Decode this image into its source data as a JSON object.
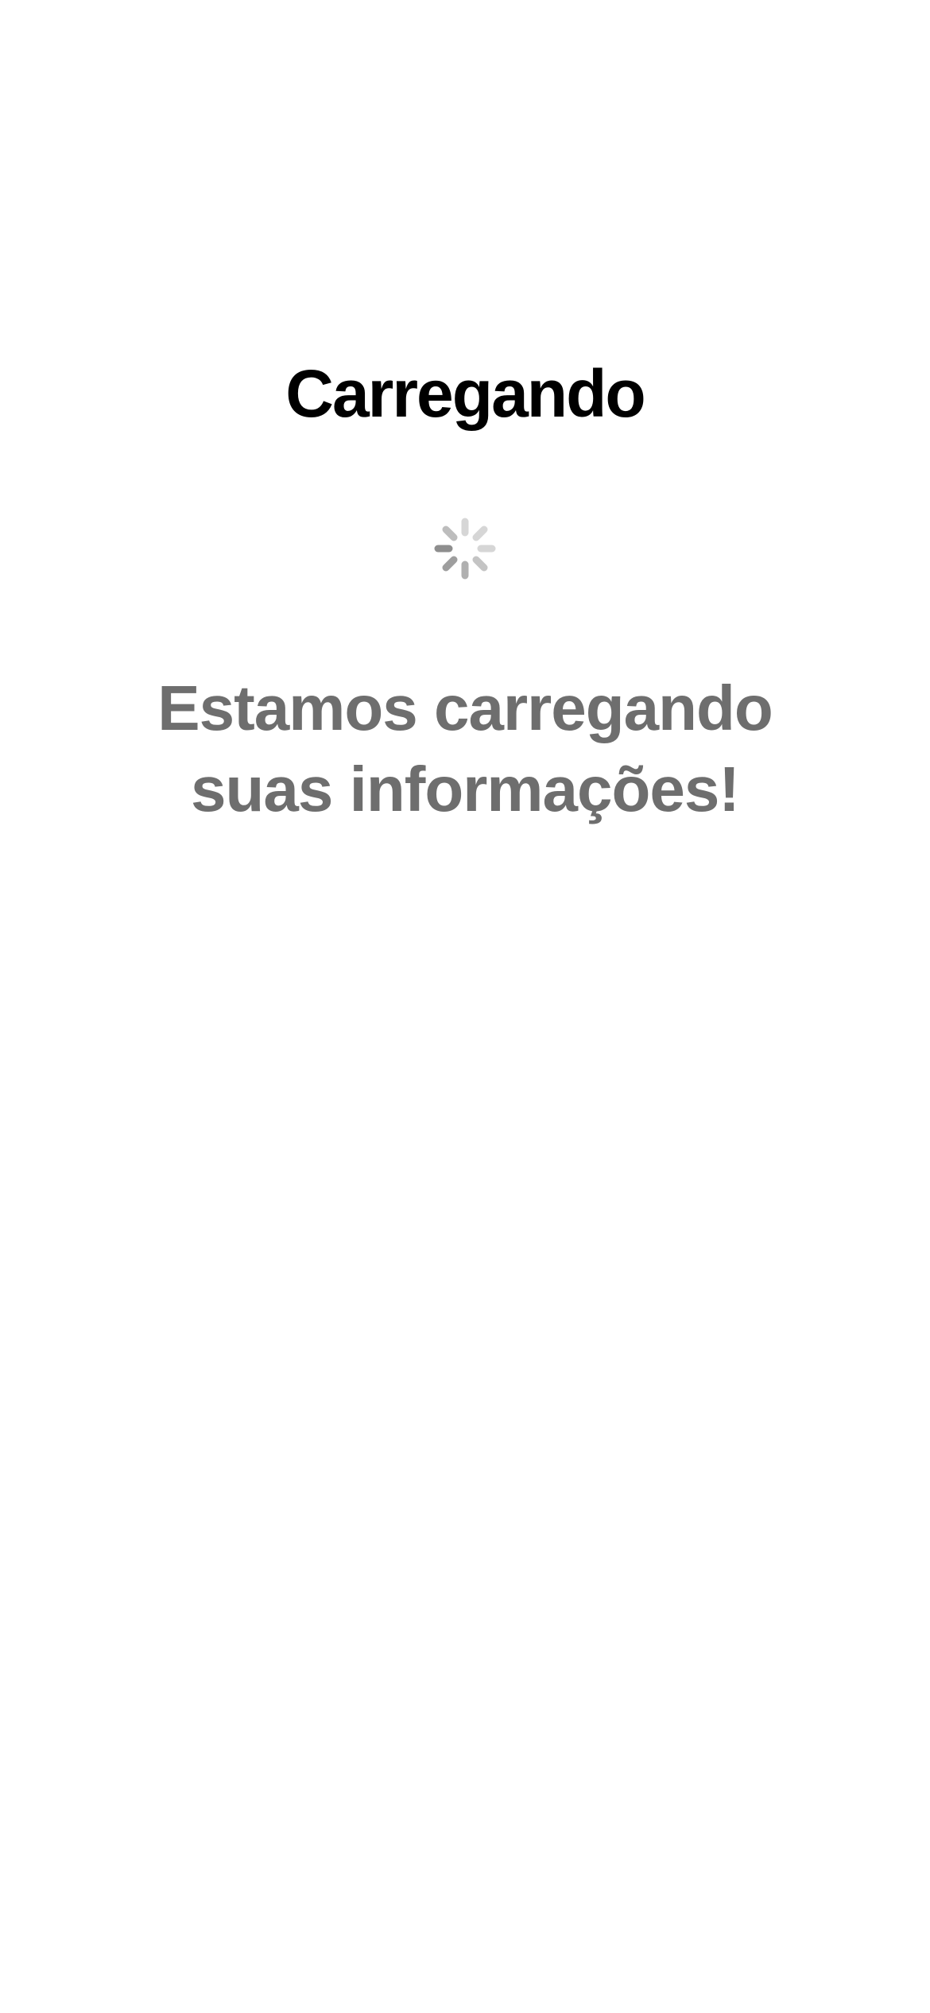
{
  "screen": {
    "title": "Carregando",
    "spinner_icon": "activity-spinner-icon",
    "message": "Estamos carregando suas informações!"
  },
  "colors": {
    "background": "#ffffff",
    "title": "#000000",
    "message": "#6e6e6e",
    "spinner_dark": "#8e8e8e",
    "spinner_light": "#d6d6d6"
  }
}
